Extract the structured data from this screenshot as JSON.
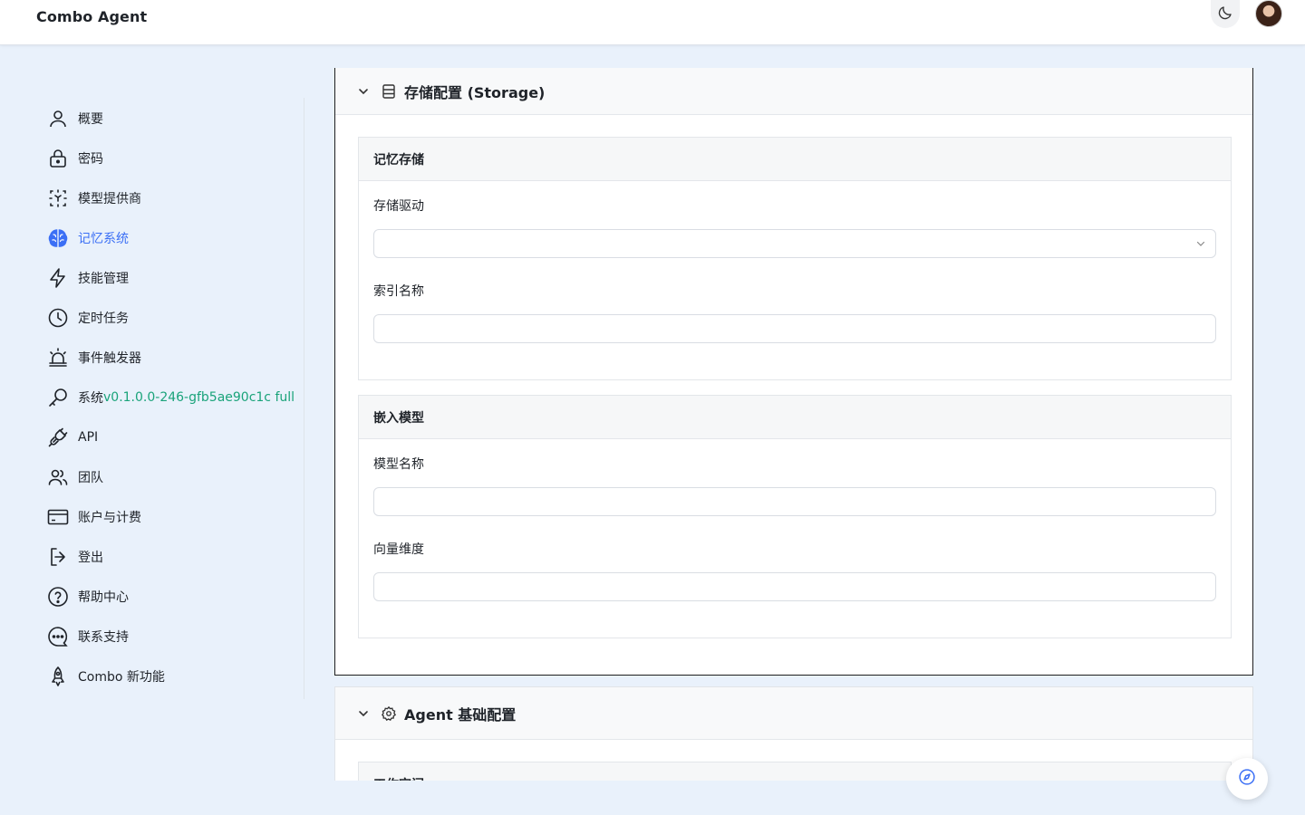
{
  "app": {
    "title": "Combo Agent"
  },
  "header": {
    "theme_icon": "moon-icon",
    "avatar_alt": "user-avatar"
  },
  "sidebar": {
    "items": [
      {
        "label": "概要",
        "icon": "user-icon"
      },
      {
        "label": "密码",
        "icon": "lock-icon"
      },
      {
        "label": "模型提供商",
        "icon": "model-provider-icon"
      },
      {
        "label": "记忆系统",
        "icon": "brain-icon",
        "active": true
      },
      {
        "label": "技能管理",
        "icon": "lightning-icon"
      },
      {
        "label": "定时任务",
        "icon": "clock-icon"
      },
      {
        "label": "事件触发器",
        "icon": "siren-icon"
      },
      {
        "label": "系统",
        "version": "v0.1.0.0-246-gfb5ae90c1c full",
        "icon": "wrench-icon"
      },
      {
        "label": "API",
        "icon": "plug-icon"
      },
      {
        "label": "团队",
        "icon": "team-icon"
      },
      {
        "label": "账户与计费",
        "icon": "credit-card-icon"
      },
      {
        "label": "登出",
        "icon": "logout-icon"
      },
      {
        "label": "帮助中心",
        "icon": "help-icon"
      },
      {
        "label": "联系支持",
        "icon": "chat-icon"
      },
      {
        "label": "Combo 新功能",
        "icon": "rocket-icon"
      }
    ]
  },
  "storage_section": {
    "title": "存储配置 (Storage)",
    "memory_card": {
      "title": "记忆存储",
      "driver_label": "存储驱动",
      "driver_value": "",
      "index_label": "索引名称",
      "index_value": ""
    },
    "embedding_card": {
      "title": "嵌入模型",
      "model_label": "模型名称",
      "model_value": "",
      "dimension_label": "向量维度",
      "dimension_value": ""
    }
  },
  "agent_section": {
    "title": "Agent 基础配置",
    "first_card_title": "工作空间"
  },
  "colors": {
    "accent": "#3b6ff5",
    "version_green": "#1aa37a",
    "background": "#e9f1fb"
  }
}
